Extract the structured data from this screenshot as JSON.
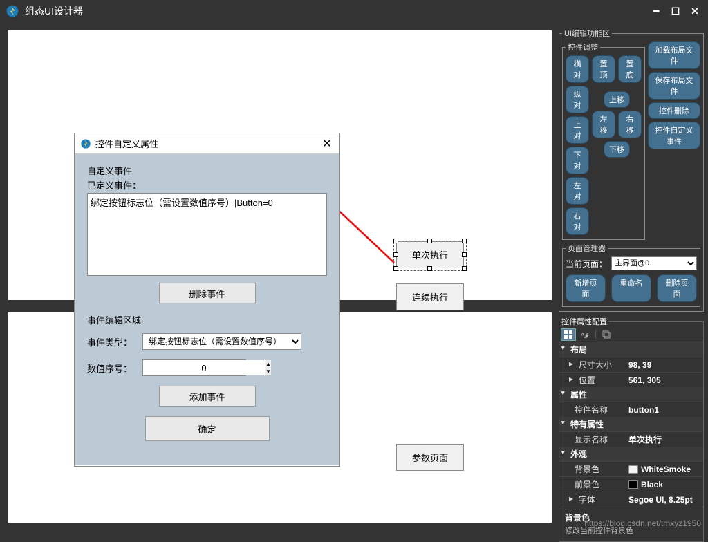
{
  "titlebar": {
    "title": "组态UI设计器"
  },
  "canvas": {
    "btn_single": "单次执行",
    "btn_continuous": "连续执行",
    "btn_param_page": "参数页面"
  },
  "dialog": {
    "title": "控件自定义属性",
    "custom_event_label": "自定义事件",
    "defined_events_label": "已定义事件：",
    "event_line": "绑定按钮标志位（需设置数值序号）|Button=0",
    "btn_delete": "删除事件",
    "edit_area_label": "事件编辑区域",
    "event_type_label": "事件类型：",
    "event_type_value": "绑定按钮标志位（需设置数值序号）",
    "num_index_label": "数值序号：",
    "num_index_value": "0",
    "btn_add": "添加事件",
    "btn_ok": "确定"
  },
  "right": {
    "tools_legend": "UI编辑功能区",
    "adjust_legend": "控件调整",
    "pills_col1": [
      "横对",
      "纵对",
      "上对",
      "下对",
      "左对",
      "右对"
    ],
    "pills_col2": {
      "top": "置顶",
      "bottom": "置底",
      "up": "上移",
      "left": "左移",
      "right": "右移",
      "down": "下移"
    },
    "pills_col3": [
      "加载布局文件",
      "保存布局文件",
      "控件删除",
      "控件自定义事件"
    ],
    "pagemgr_legend": "页面管理器",
    "current_page_label": "当前页面：",
    "current_page_value": "主界面@0",
    "page_btns": {
      "add": "新增页面",
      "rename": "重命名",
      "delete": "删除页面"
    },
    "propcfg_legend": "控件属性配置"
  },
  "props": {
    "cat_layout": "布局",
    "size_k": "尺寸大小",
    "size_v": "98, 39",
    "pos_k": "位置",
    "pos_v": "561, 305",
    "cat_attr": "属性",
    "name_k": "控件名称",
    "name_v": "button1",
    "cat_special": "特有属性",
    "disp_k": "显示名称",
    "disp_v": "单次执行",
    "cat_appear": "外观",
    "bg_k": "背景色",
    "bg_v": "WhiteSmoke",
    "bg_color": "#f5f5f5",
    "fg_k": "前景色",
    "fg_v": "Black",
    "fg_color": "#000000",
    "font_k": "字体",
    "font_v": "Segoe UI, 8.25pt",
    "desc_title": "背景色",
    "desc_text": "修改当前控件背景色"
  },
  "watermark": "https://blog.csdn.net/tmxyz1950"
}
